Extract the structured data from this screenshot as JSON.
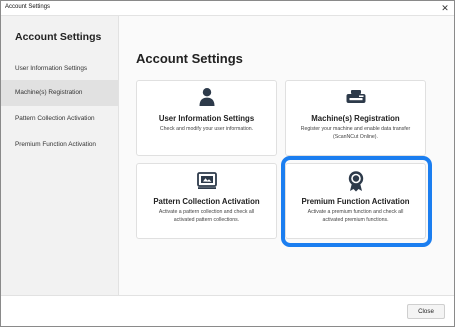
{
  "window": {
    "title": "Account Settings"
  },
  "sidebar": {
    "title": "Account Settings",
    "items": [
      {
        "label": "User Information Settings"
      },
      {
        "label": "Machine(s) Registration"
      },
      {
        "label": "Pattern Collection Activation"
      },
      {
        "label": "Premium Function Activation"
      }
    ]
  },
  "main": {
    "title": "Account Settings",
    "cards": [
      {
        "title": "User Information Settings",
        "desc1": "Check and modify your user information.",
        "desc2": "",
        "icon": "person-icon"
      },
      {
        "title": "Machine(s) Registration",
        "desc1": "Register your machine and enable data transfer",
        "desc2": "(ScanNCut Online).",
        "icon": "cutting-machine-icon"
      },
      {
        "title": "Pattern Collection Activation",
        "desc1": "Activate a pattern collection and check all",
        "desc2": "activated pattern collections.",
        "icon": "pattern-collection-icon"
      },
      {
        "title": "Premium Function Activation",
        "desc1": "Activate a premium function and check all",
        "desc2": "activated premium functions.",
        "icon": "premium-badge-icon"
      }
    ]
  },
  "footer": {
    "close_label": "Close"
  },
  "colors": {
    "accent": "#1b7ef0",
    "icon": "#2d3a4a",
    "sidebar_bg": "#f2f2f2",
    "active_item": "#e1e1e1"
  }
}
